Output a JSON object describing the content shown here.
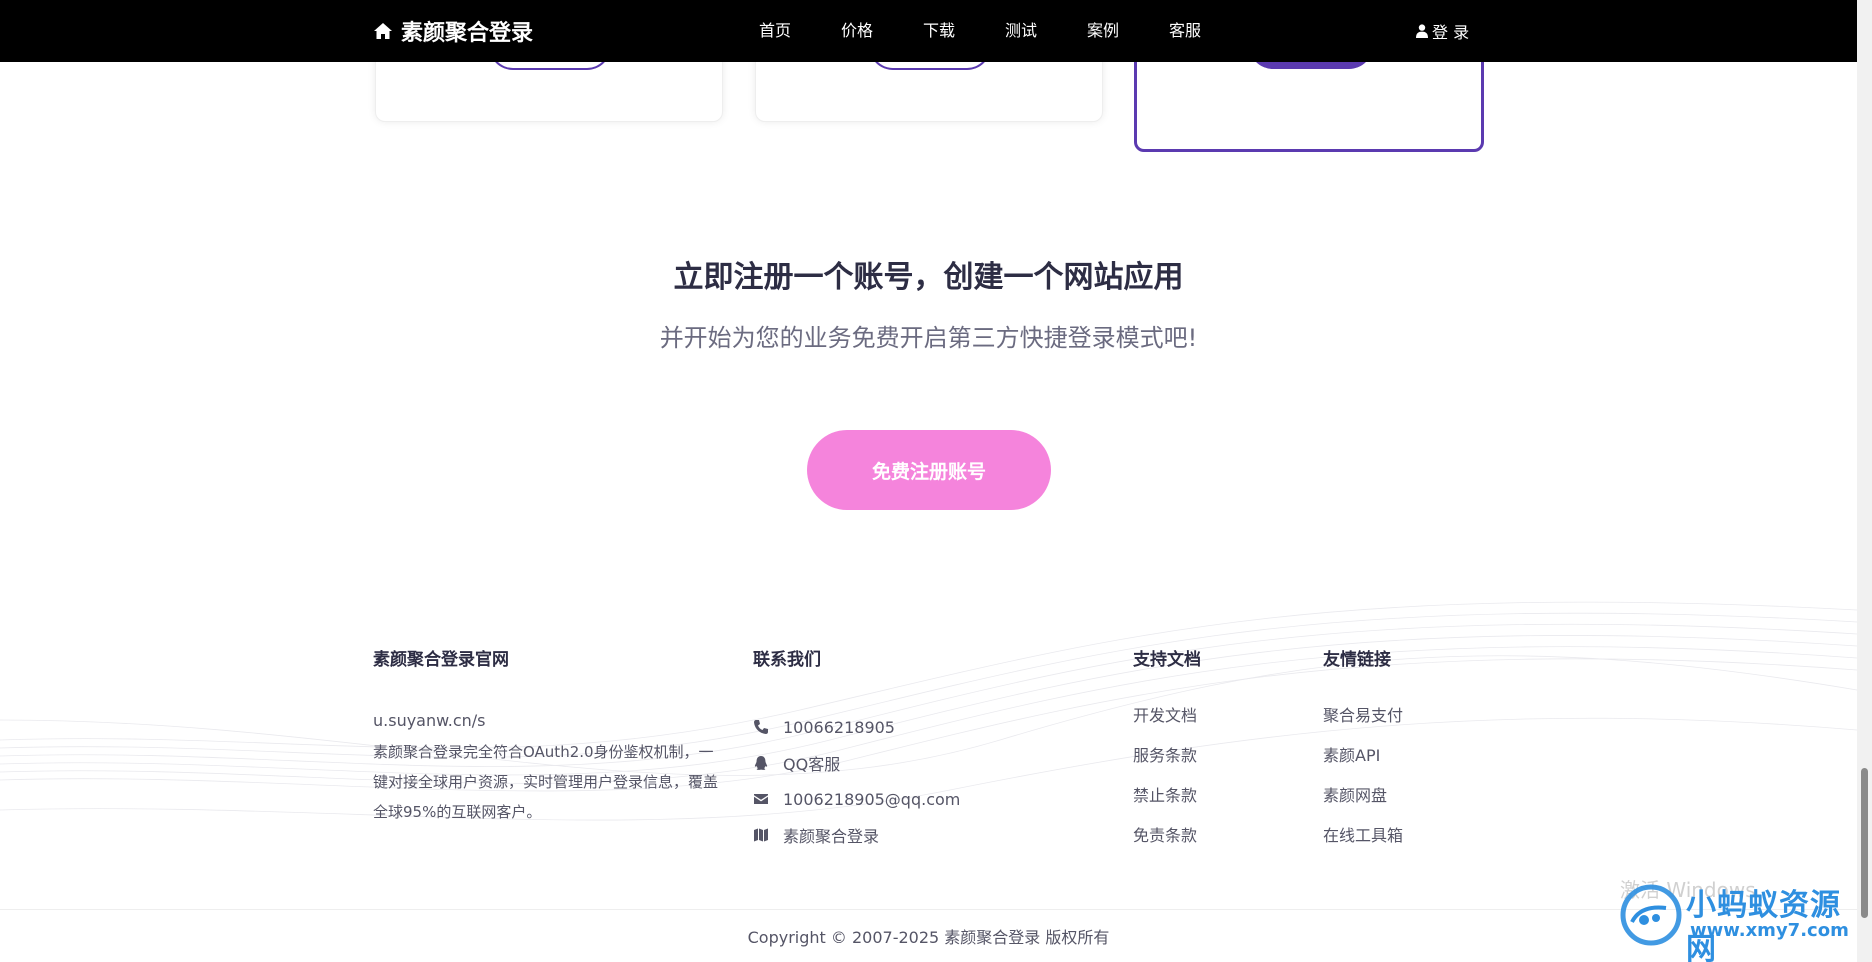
{
  "nav": {
    "brand": "素颜聚合登录",
    "links": [
      "首页",
      "价格",
      "下载",
      "测试",
      "案例",
      "客服"
    ],
    "login": "登 录"
  },
  "cta": {
    "title": "立即注册一个账号，创建一个网站应用",
    "subtitle": "并开始为您的业务免费开启第三方快捷登录模式吧!",
    "button": "免费注册账号"
  },
  "footer": {
    "about": {
      "heading": "素颜聚合登录官网",
      "url": "u.suyanw.cn/s",
      "desc": "素颜聚合登录完全符合OAuth2.0身份鉴权机制，一键对接全球用户资源，实时管理用户登录信息，覆盖全球95%的互联网客户。"
    },
    "contact": {
      "heading": "联系我们",
      "items": [
        {
          "icon": "phone-icon",
          "text": "10066218905"
        },
        {
          "icon": "qq-icon",
          "text": "QQ客服"
        },
        {
          "icon": "envelope-icon",
          "text": "1006218905@qq.com"
        },
        {
          "icon": "map-icon",
          "text": "素颜聚合登录"
        }
      ]
    },
    "docs": {
      "heading": "支持文档",
      "items": [
        "开发文档",
        "服务条款",
        "禁止条款",
        "免责条款"
      ]
    },
    "links": {
      "heading": "友情链接",
      "items": [
        "聚合易支付",
        "素颜API",
        "素颜网盘",
        "在线工具箱"
      ]
    },
    "copyright": "Copyright © 2007-2025 素颜聚合登录 版权所有"
  },
  "watermark": {
    "faint": "激活 Windows",
    "title": "小蚂蚁资源网",
    "url": "www.xmy7.com"
  },
  "colors": {
    "accent": "#5b3ab0",
    "cta_button": "#f584dc",
    "nav_bg": "#000000"
  }
}
